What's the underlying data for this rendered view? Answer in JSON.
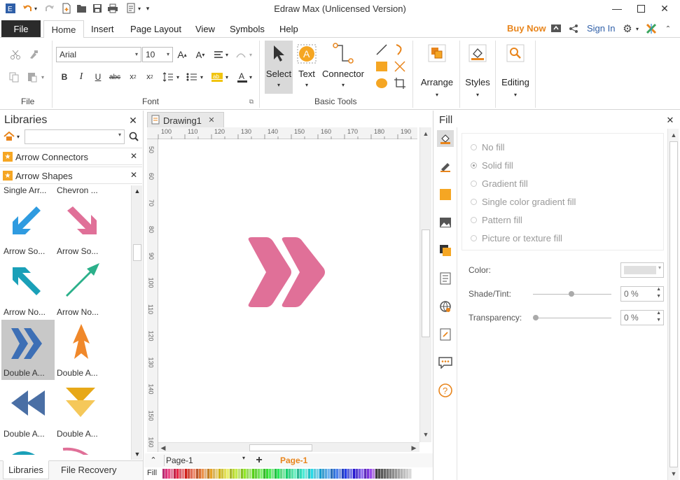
{
  "window": {
    "title": "Edraw Max (Unlicensed Version)"
  },
  "menu": {
    "file": "File",
    "tabs": [
      "Home",
      "Insert",
      "Page Layout",
      "View",
      "Symbols",
      "Help"
    ],
    "buy_now": "Buy Now",
    "sign_in": "Sign In"
  },
  "ribbon": {
    "groups": {
      "file": "File",
      "font": "Font",
      "basic_tools": "Basic Tools"
    },
    "font_name": "Arial",
    "font_size": "10",
    "tools": {
      "select": "Select",
      "text": "Text",
      "connector": "Connector",
      "arrange": "Arrange",
      "styles": "Styles",
      "editing": "Editing"
    }
  },
  "libraries": {
    "title": "Libraries",
    "sections": [
      "Arrow Connectors",
      "Arrow Shapes"
    ],
    "shapes": [
      {
        "label": "Single Arr...",
        "icon": "none"
      },
      {
        "label": "Chevron ...",
        "icon": "none"
      },
      {
        "label": "Arrow So...",
        "icon": "blue-diagonal-arrow-icon"
      },
      {
        "label": "Arrow So...",
        "icon": "pink-diagonal-arrow-icon"
      },
      {
        "label": "Arrow No...",
        "icon": "teal-diagonal-arrow-icon"
      },
      {
        "label": "Arrow No...",
        "icon": "teal-long-arrow-icon"
      },
      {
        "label": "Double A...",
        "icon": "blue-double-chevron-icon"
      },
      {
        "label": "Double A...",
        "icon": "orange-up-arrow-icon"
      },
      {
        "label": "Double A...",
        "icon": "blue-double-left-icon"
      },
      {
        "label": "Double A...",
        "icon": "yellow-double-down-icon"
      }
    ],
    "bottom_tabs": [
      "Libraries",
      "File Recovery"
    ]
  },
  "document": {
    "tab": "Drawing1",
    "ruler_top": [
      "100",
      "110",
      "120",
      "130",
      "140",
      "150",
      "160",
      "170",
      "180",
      "190"
    ],
    "ruler_left": [
      "50",
      "60",
      "70",
      "80",
      "90",
      "100",
      "110",
      "120",
      "130",
      "140",
      "150",
      "160"
    ],
    "page_selector": "Page-1",
    "active_page": "Page-1",
    "fill_label": "Fill"
  },
  "fill_panel": {
    "title": "Fill",
    "options": [
      "No fill",
      "Solid fill",
      "Gradient fill",
      "Single color gradient fill",
      "Pattern fill",
      "Picture or texture fill"
    ],
    "selected_option": "Solid fill",
    "color_label": "Color:",
    "shade_label": "Shade/Tint:",
    "shade_value": "0 %",
    "transparency_label": "Transparency:",
    "transparency_value": "0 %"
  },
  "colors": {
    "accent": "#e8851c",
    "chevron": "#e07098",
    "selected_shape_bg": "#c8c8c8"
  }
}
